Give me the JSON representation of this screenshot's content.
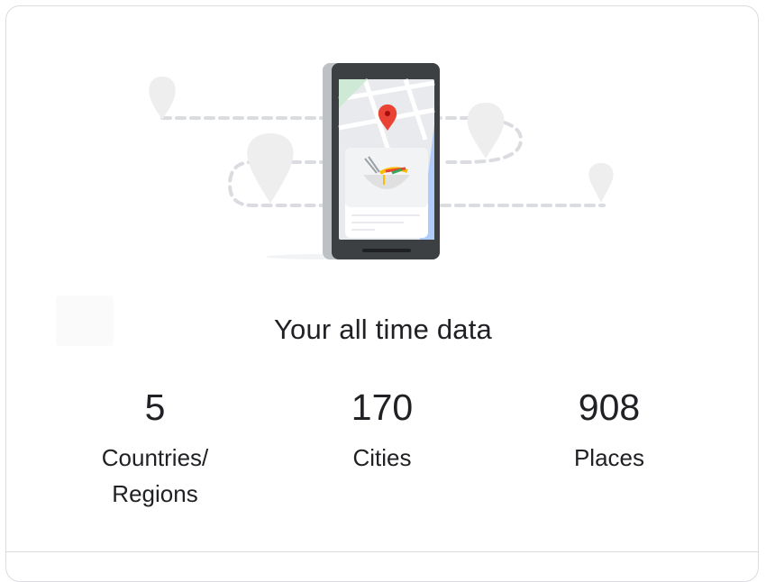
{
  "card": {
    "title": "Your all time data",
    "illustration_icons": [
      "map-pin-icon",
      "phone-icon",
      "food-bowl-icon"
    ],
    "stats": {
      "countries": {
        "value": "5",
        "label": "Countries/\nRegions"
      },
      "cities": {
        "value": "170",
        "label": "Cities"
      },
      "places": {
        "value": "908",
        "label": "Places"
      }
    }
  },
  "colors": {
    "text": "#202124",
    "border": "#dadce0",
    "pin_red": "#ea4335",
    "phone_frame": "#3c4043",
    "map_green": "#ceead6",
    "map_blue": "#aecbfa"
  }
}
